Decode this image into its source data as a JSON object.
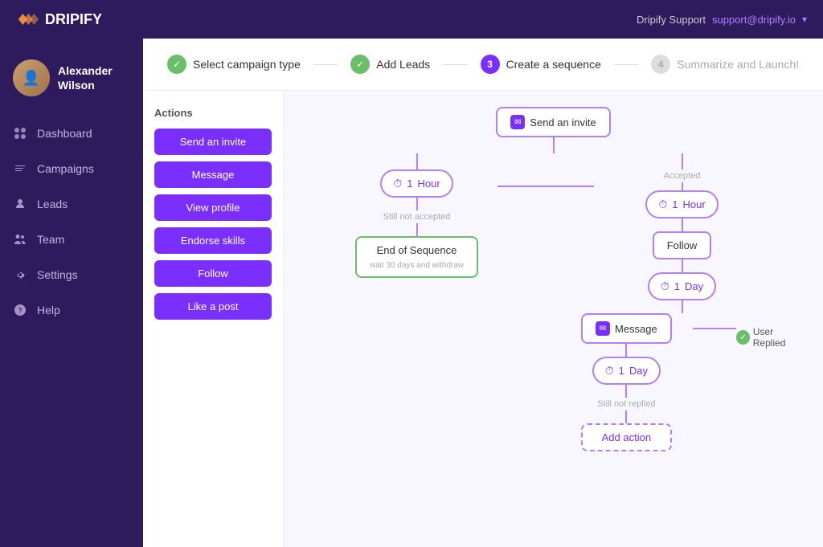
{
  "topbar": {
    "logo": "DRIPIFY",
    "user_name": "Dripify Support",
    "user_email": "support@dripify.io"
  },
  "sidebar": {
    "user": {
      "name": "Alexander Wilson"
    },
    "items": [
      {
        "id": "dashboard",
        "label": "Dashboard",
        "icon": "dashboard-icon"
      },
      {
        "id": "campaigns",
        "label": "Campaigns",
        "icon": "campaigns-icon"
      },
      {
        "id": "leads",
        "label": "Leads",
        "icon": "leads-icon"
      },
      {
        "id": "team",
        "label": "Team",
        "icon": "team-icon"
      },
      {
        "id": "settings",
        "label": "Settings",
        "icon": "settings-icon"
      },
      {
        "id": "help",
        "label": "Help",
        "icon": "help-icon"
      }
    ]
  },
  "steps": [
    {
      "id": "step1",
      "label": "Select campaign type",
      "status": "done",
      "num": "1"
    },
    {
      "id": "step2",
      "label": "Add Leads",
      "status": "done",
      "num": "2"
    },
    {
      "id": "step3",
      "label": "Create a sequence",
      "status": "active",
      "num": "3"
    },
    {
      "id": "step4",
      "label": "Summarize and Launch!",
      "status": "inactive",
      "num": "4"
    }
  ],
  "actions_panel": {
    "title": "Actions",
    "buttons": [
      {
        "id": "send-invite",
        "label": "Send an invite"
      },
      {
        "id": "message",
        "label": "Message"
      },
      {
        "id": "view-profile",
        "label": "View profile"
      },
      {
        "id": "endorse-skills",
        "label": "Endorse skills"
      },
      {
        "id": "follow",
        "label": "Follow"
      },
      {
        "id": "like-post",
        "label": "Like a post"
      }
    ]
  },
  "flow": {
    "start_node": "Send an invite",
    "timer1": {
      "value": "1",
      "unit": "Hour"
    },
    "branch_left_label": "Still not accepted",
    "branch_right_label": "Accepted",
    "end_node": "End of Sequence",
    "end_node_sub": "wait 30 days and withdraw",
    "timer2": {
      "value": "1",
      "unit": "Hour"
    },
    "follow_node": "Follow",
    "timer3": {
      "value": "1",
      "unit": "Day"
    },
    "message_node": "Message",
    "timer4": {
      "value": "1",
      "unit": "Day"
    },
    "user_replied_label": "User Replied",
    "still_not_replied_label": "Still not replied",
    "add_action_label": "Add action"
  },
  "colors": {
    "purple_dark": "#2d1b5e",
    "purple_main": "#7b2fff",
    "purple_light": "#b47fff",
    "green": "#6abf69",
    "text_muted": "#aaa"
  }
}
